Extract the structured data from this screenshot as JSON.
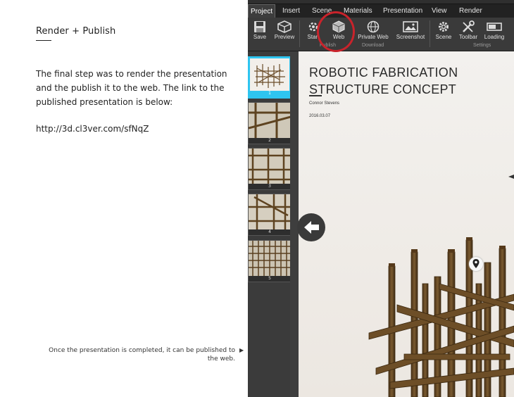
{
  "document": {
    "title": "Render + Publish",
    "body": "The final step was to render the presentation and the publish it to the web. The link to the published presentation is below:",
    "link": "http://3d.cl3ver.com/sfNqZ",
    "caption": "Once the presentation is completed, it can be published to the web.",
    "caption_arrow": "▶"
  },
  "menu": [
    "Project",
    "Insert",
    "Scene",
    "Materials",
    "Presentation",
    "View",
    "Render"
  ],
  "menu_active": "Project",
  "ribbon": {
    "save": "Save",
    "preview": "Preview",
    "start": "Start",
    "web": "Web",
    "private_web": "Private Web",
    "screenshot": "Screenshot",
    "scene": "Scene",
    "toolbar": "Toolbar",
    "loading": "Loading",
    "groups": {
      "publish": "Publish",
      "download": "Download",
      "settings": "Settings"
    }
  },
  "slides": [
    "1",
    "2",
    "3",
    "4",
    "5"
  ],
  "viewport": {
    "title_line1": "ROBOTIC FABRICATION",
    "title_line2": "STRUCTURE CONCEPT",
    "author": "Connor Stevens",
    "date": "2016.03.07"
  },
  "colors": {
    "accent": "#2ec5f0",
    "highlight": "#c9232b",
    "dark": "#2f2f2f"
  },
  "icons": [
    "save-icon",
    "preview-icon",
    "start-icon",
    "web-cube-icon",
    "globe-icon",
    "screenshot-icon",
    "gear-icon",
    "wrench-icon",
    "loading-icon",
    "back-arrow-icon",
    "location-pin-icon"
  ]
}
